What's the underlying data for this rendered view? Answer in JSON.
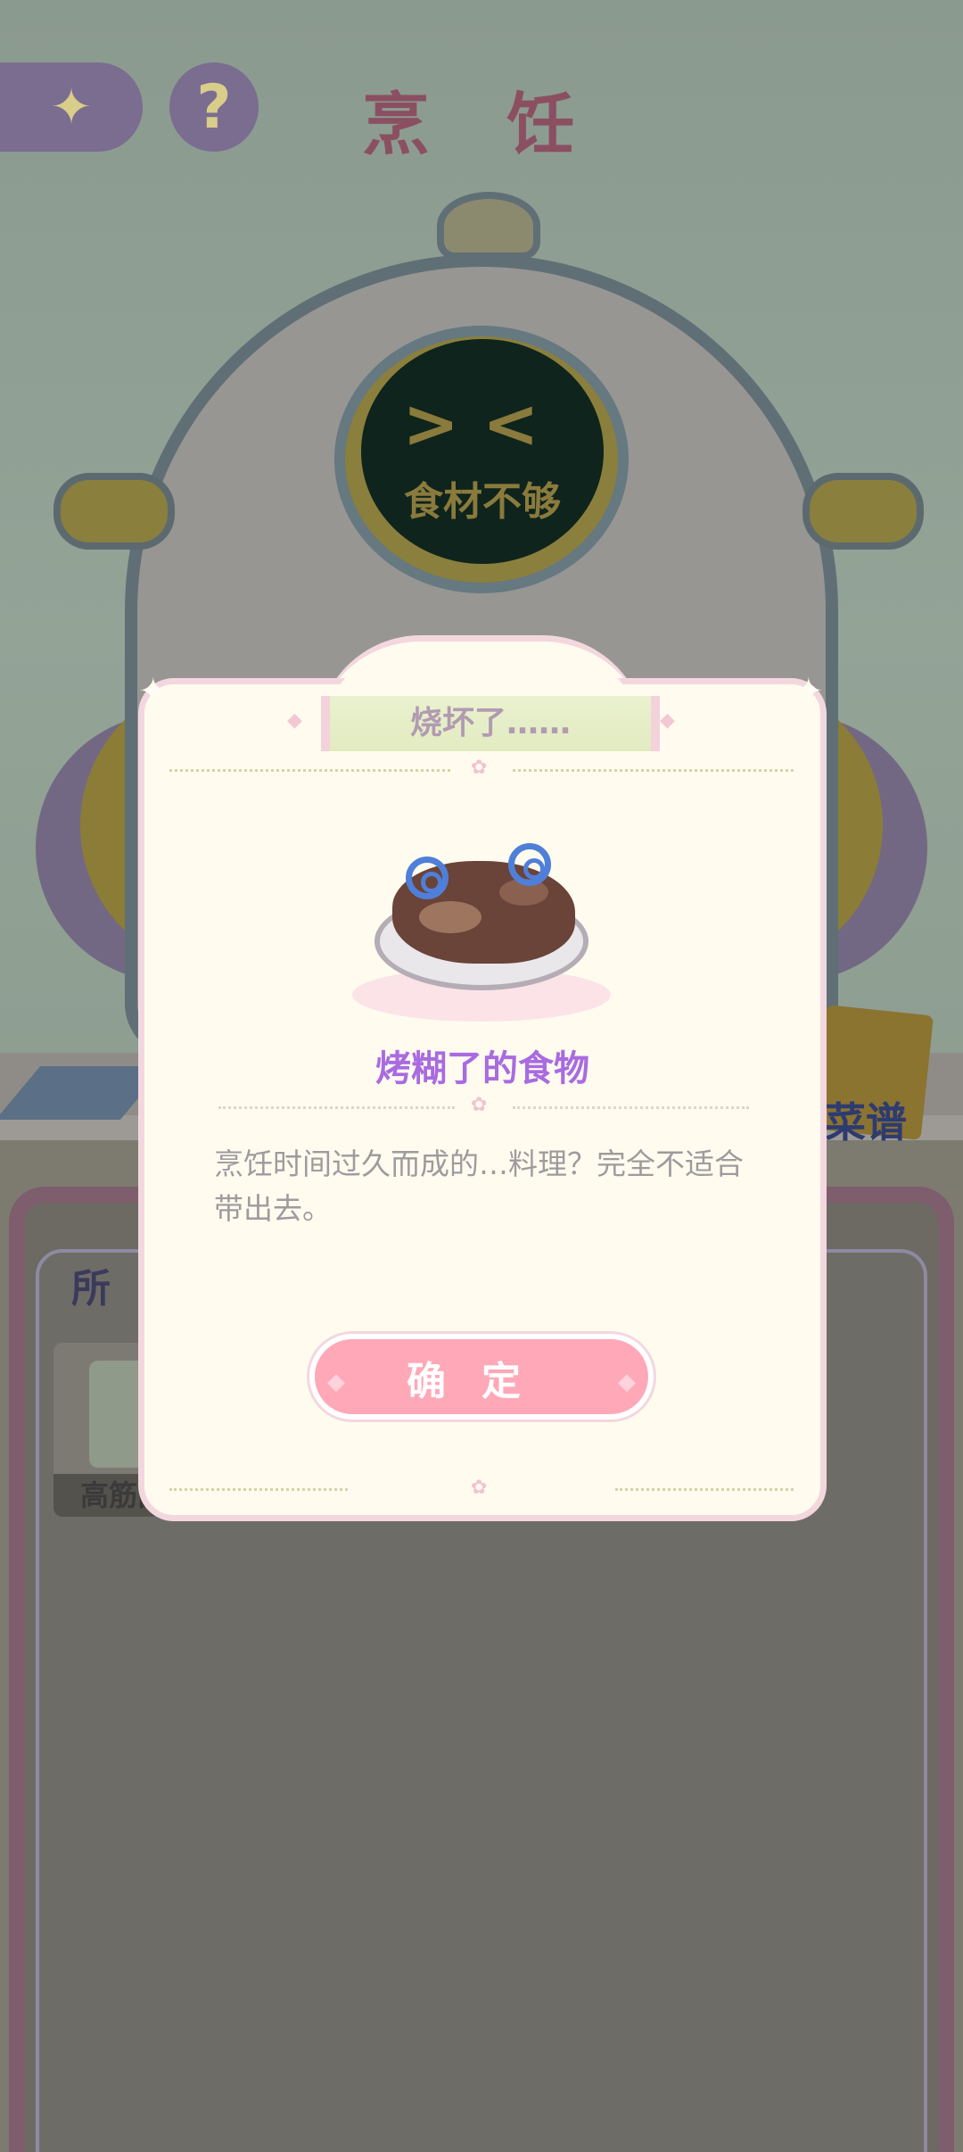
{
  "header": {
    "back_icon": "back-arrow-icon",
    "help_label": "?",
    "title": "烹 饪"
  },
  "pot_screen": {
    "face": "><",
    "message": "食材不够"
  },
  "recipe_button": {
    "label": "菜谱"
  },
  "inventory": {
    "category_label": "所 有",
    "items": [
      {
        "name": "高筋面粉"
      }
    ]
  },
  "dialog": {
    "title": "烧坏了……",
    "food_name": "烤糊了的食物",
    "description": "烹饪时间过久而成的…料理？完全不适合带出去。",
    "confirm_label": "确定"
  },
  "colors": {
    "accent_pink": "#ffa8b8",
    "food_name_purple": "#a96be0",
    "dialog_bg": "#fffcef"
  }
}
